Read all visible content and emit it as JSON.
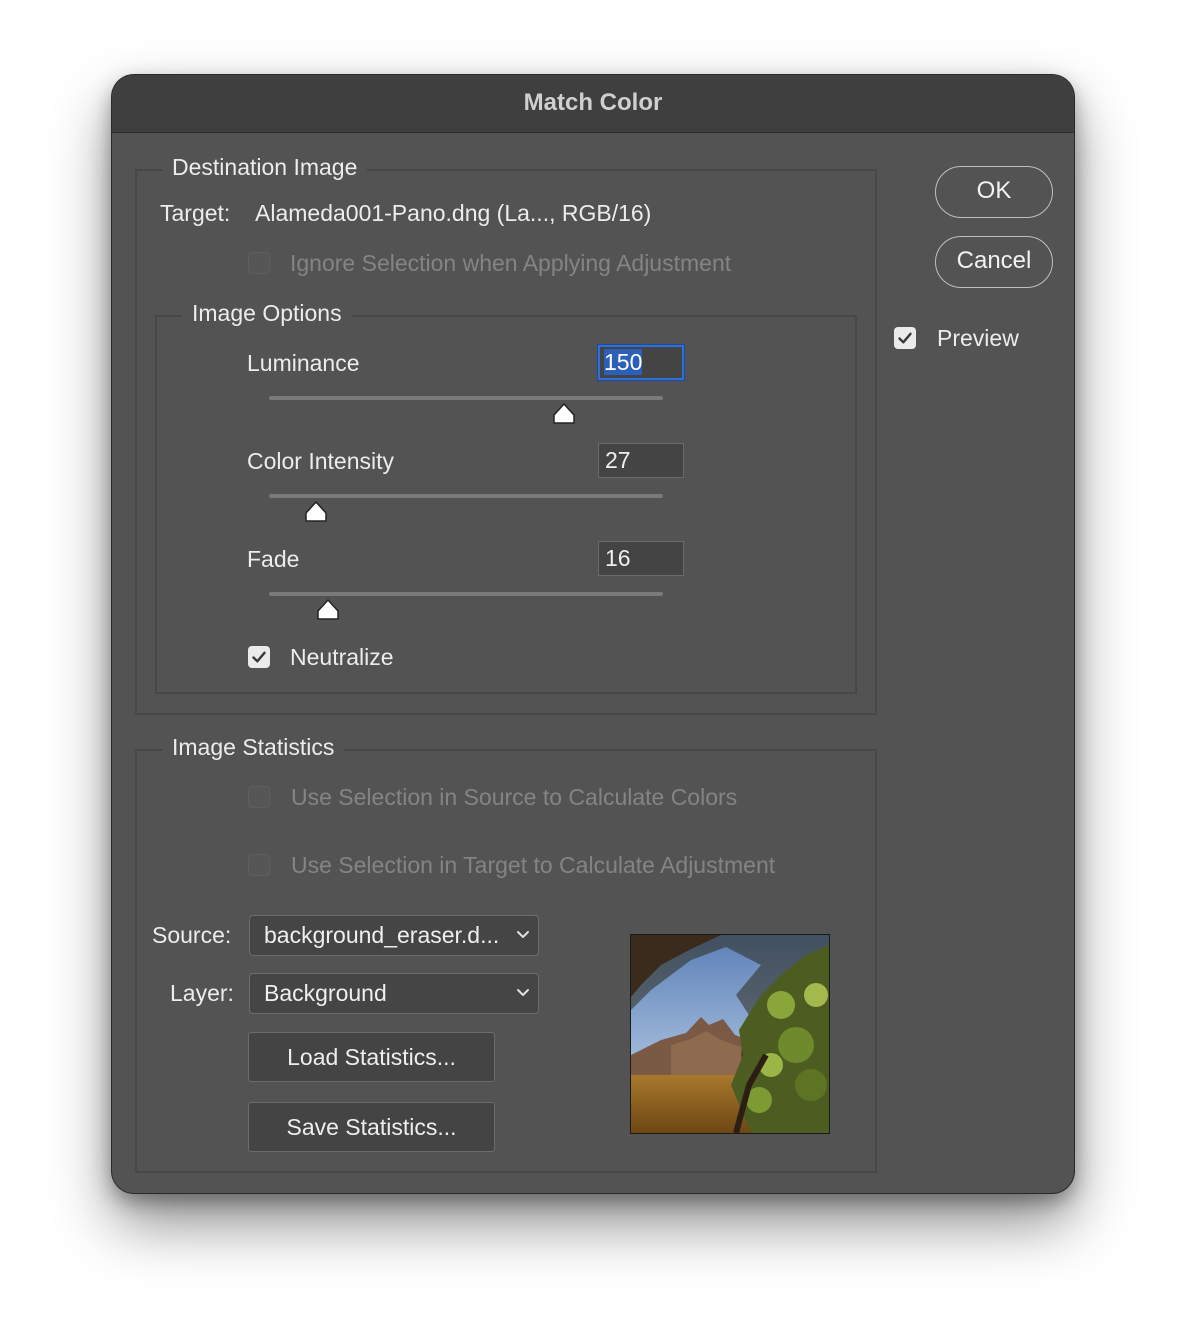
{
  "window": {
    "title": "Match Color"
  },
  "destination": {
    "legend": "Destination Image",
    "target_label": "Target:",
    "target_value": "Alameda001-Pano.dng (La..., RGB/16)",
    "ignore_selection": {
      "label": "Ignore Selection when Applying Adjustment",
      "checked": false,
      "enabled": false
    }
  },
  "image_options": {
    "legend": "Image Options",
    "luminance": {
      "label": "Luminance",
      "value": "150",
      "range": [
        1,
        200
      ]
    },
    "color_intensity": {
      "label": "Color Intensity",
      "value": "27",
      "range": [
        1,
        200
      ]
    },
    "fade": {
      "label": "Fade",
      "value": "16",
      "range": [
        0,
        100
      ]
    },
    "neutralize": {
      "label": "Neutralize",
      "checked": true
    }
  },
  "statistics": {
    "legend": "Image Statistics",
    "use_source_selection": {
      "label": "Use Selection in Source to Calculate Colors",
      "checked": false,
      "enabled": false
    },
    "use_target_selection": {
      "label": "Use Selection in Target to Calculate Adjustment",
      "checked": false,
      "enabled": false
    },
    "source_label": "Source:",
    "source_value": "background_eraser.d...",
    "layer_label": "Layer:",
    "layer_value": "Background",
    "load_button": "Load Statistics...",
    "save_button": "Save Statistics..."
  },
  "buttons": {
    "ok": "OK",
    "cancel": "Cancel"
  },
  "preview": {
    "label": "Preview",
    "checked": true
  },
  "colors": {
    "background": "#535353",
    "titlebar": "#3f3f3f",
    "focus": "#2f6fd6"
  }
}
